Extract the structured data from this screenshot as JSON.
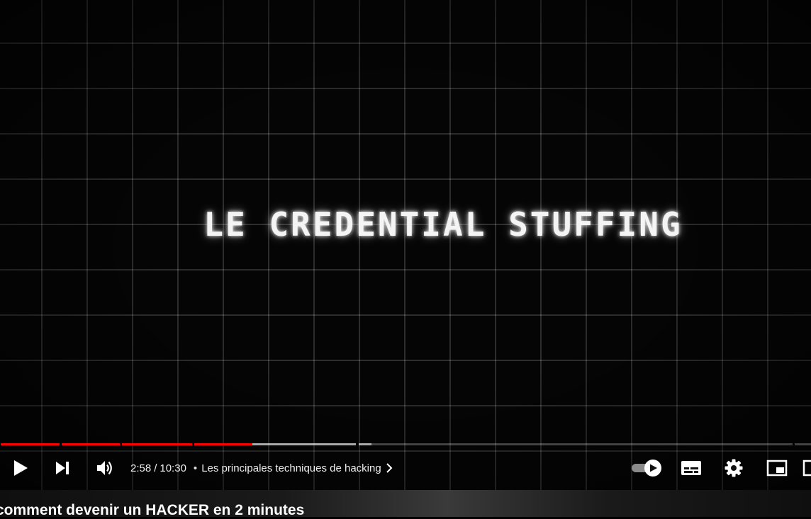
{
  "video": {
    "overlay_text": "LE CREDENTIAL STUFFING"
  },
  "player": {
    "progress": {
      "current_seconds": 178,
      "duration_seconds": 630
    },
    "time_current": "2:58",
    "time_separator": "/",
    "time_duration": "10:30",
    "bullet": "•",
    "chapter_title": "Les principales techniques de hacking",
    "buttons": {
      "play": "play-icon",
      "next": "next-icon",
      "volume": "volume-icon",
      "autoplay": "autoplay-toggle-icon",
      "subtitles": "subtitles-icon",
      "settings": "gear-icon",
      "miniplayer": "miniplayer-icon",
      "theater": "theater-icon"
    },
    "colors": {
      "progress": "#ff0000",
      "buffer": "#9a9a9a"
    }
  },
  "page": {
    "video_title": "comment devenir un HACKER en 2 minutes"
  }
}
